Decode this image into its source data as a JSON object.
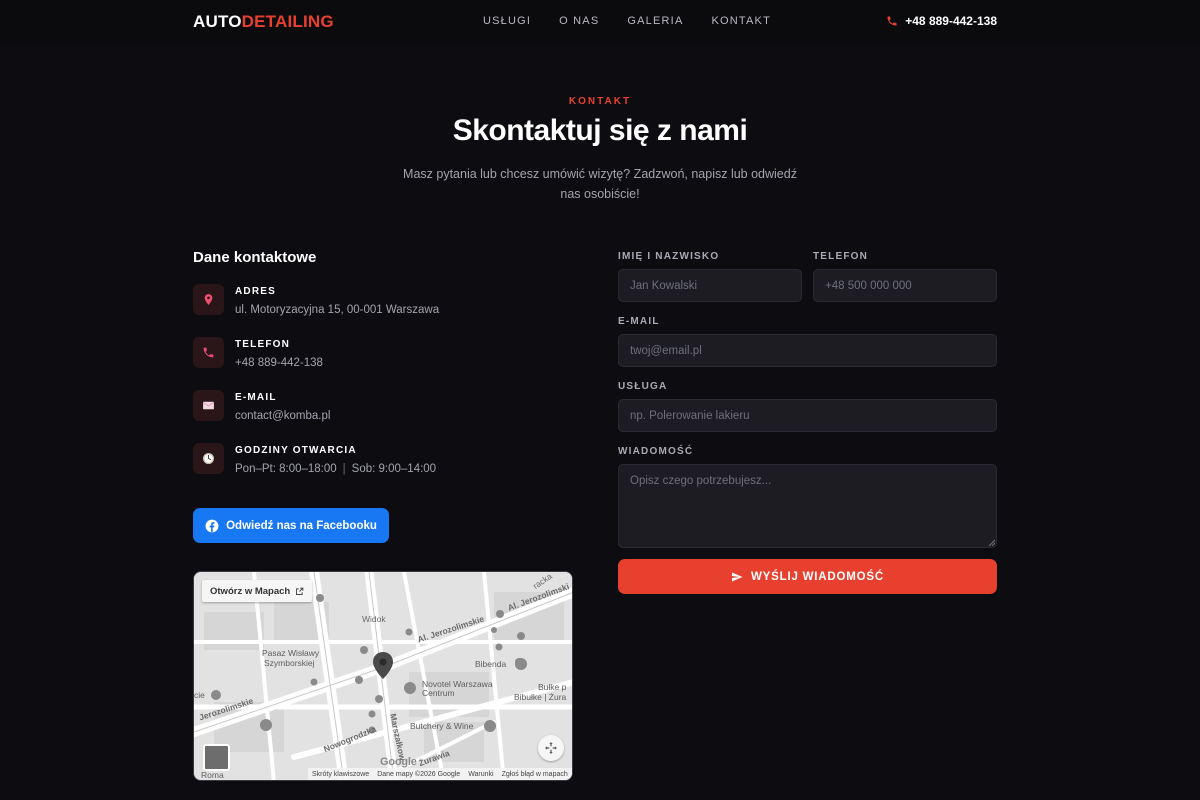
{
  "header": {
    "logo_part1": "AUTO",
    "logo_part2": "DETAILING",
    "nav": [
      "USŁUGI",
      "O NAS",
      "GALERIA",
      "KONTAKT"
    ],
    "phone": "+48 889-442-138"
  },
  "hero": {
    "eyebrow": "KONTAKT",
    "title": "Skontaktuj się z nami",
    "subtitle": "Masz pytania lub chcesz umówić wizytę? Zadzwoń, napisz lub odwiedź nas osobiście!"
  },
  "contact": {
    "section_title": "Dane kontaktowe",
    "items": [
      {
        "label": "ADRES",
        "value": "ul. Motoryzacyjna 15, 00-001 Warszawa",
        "icon": "map-pin-icon"
      },
      {
        "label": "TELEFON",
        "value": "+48 889-442-138",
        "icon": "phone-icon"
      },
      {
        "label": "E-MAIL",
        "value": "contact@komba.pl",
        "icon": "envelope-icon"
      },
      {
        "label": "GODZINY OTWARCIA",
        "value_a": "Pon–Pt: 8:00–18:00",
        "value_sep": "|",
        "value_b": "Sob: 9:00–14:00",
        "icon": "clock-icon"
      }
    ],
    "facebook_label": "Odwiedź nas na Facebooku"
  },
  "map": {
    "open_label": "Otwórz w Mapach",
    "labels": {
      "widok": "Widok",
      "jerozolimskie_1": "Al. Jerozolimskie",
      "jerozolimskie_2": "Al. Jerozolimski",
      "jerozolimskie_3": "Jerozolimskie",
      "plac": "Pasaz Wisławy",
      "plac2": "Szymborskiej",
      "bibenda": "Bibenda",
      "novotel": "Novotel Warszawa",
      "novotel2": "Centrum",
      "bulke": "Bułke p",
      "bibulke": "Bibułke | Żura",
      "butchery": "Butchery & Wine",
      "nowogrodzka": "Nowogrodzka",
      "marszalkow": "Marszałkow",
      "zurawia": "Żurawia",
      "roma": "Roma",
      "cie": "cie",
      "racka": "racka",
      "google": "Google"
    },
    "footer": [
      "Skróty klawiszowe",
      "Dane mapy ©2026 Google",
      "Warunki",
      "Zgłoś błąd w mapach"
    ]
  },
  "form": {
    "name_label": "IMIĘ I NAZWISKO",
    "name_placeholder": "Jan Kowalski",
    "phone_label": "TELEFON",
    "phone_placeholder": "+48 500 000 000",
    "email_label": "E-MAIL",
    "email_placeholder": "twoj@email.pl",
    "service_label": "USŁUGA",
    "service_placeholder": "np. Polerowanie lakieru",
    "message_label": "WIADOMOŚĆ",
    "message_placeholder": "Opisz czego potrzebujesz...",
    "submit_label": "WYŚLIJ WIADOMOŚĆ"
  },
  "colors": {
    "accent": "#e8402f",
    "facebook": "#1877f2",
    "background": "#0d0d11"
  }
}
